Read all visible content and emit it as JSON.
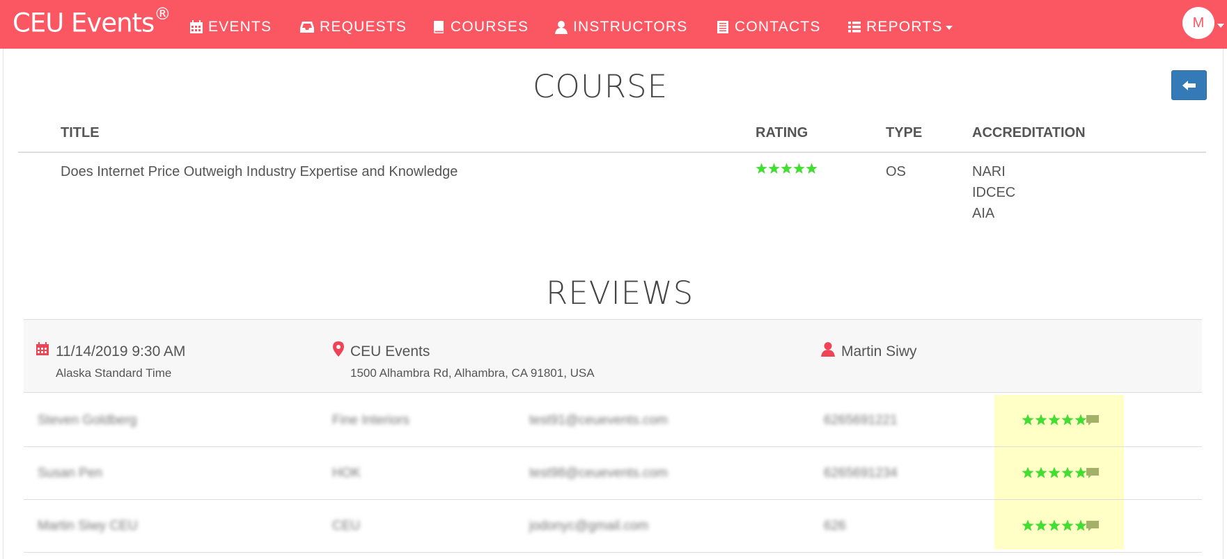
{
  "nav": {
    "brand": "CEU Events",
    "brand_mark": "®",
    "items": [
      {
        "label": "EVENTS",
        "icon": "calendar-icon"
      },
      {
        "label": "REQUESTS",
        "icon": "inbox-icon"
      },
      {
        "label": "COURSES",
        "icon": "book-icon"
      },
      {
        "label": "INSTRUCTORS",
        "icon": "user-icon"
      },
      {
        "label": "CONTACTS",
        "icon": "address-book-icon"
      },
      {
        "label": "REPORTS",
        "icon": "list-icon"
      }
    ],
    "avatar_initial": "M",
    "colors": {
      "bar": "#fb5763",
      "text": "#ffffff"
    }
  },
  "course": {
    "title": "COURSE",
    "back_icon": "arrow-left-icon",
    "headers": {
      "title": "TITLE",
      "rating": "RATING",
      "type": "TYPE",
      "accreditation": "ACCREDITATION"
    },
    "row": {
      "title": "Does Internet Price Outweigh Industry Expertise and Knowledge",
      "rating": 5,
      "type": "OS",
      "accreditations": [
        "NARI",
        "IDCEC",
        "AIA"
      ]
    }
  },
  "reviews": {
    "title": "REVIEWS",
    "event": {
      "datetime": "11/14/2019 9:30 AM",
      "timezone": "Alaska Standard Time",
      "venue": "CEU Events",
      "address": "1500 Alhambra Rd, Alhambra, CA 91801, USA",
      "instructor": "Martin Siwy"
    },
    "rows": [
      {
        "name": "Steven Goldberg",
        "company": "Fine Interiors",
        "email": "test91@ceuevents.com",
        "phone": "6265691221",
        "rating": 5
      },
      {
        "name": "Susan Pen",
        "company": "HOK",
        "email": "test98@ceuevents.com",
        "phone": "6265691234",
        "rating": 5
      },
      {
        "name": "Martin Siwy CEU",
        "company": "CEU",
        "email": "jodonyc@gmail.com",
        "phone": "626",
        "rating": 5
      }
    ],
    "colors": {
      "star": "#44dd33",
      "icon": "#ee4455",
      "highlight": "#ffffc6",
      "comment": "#a3b168"
    }
  }
}
